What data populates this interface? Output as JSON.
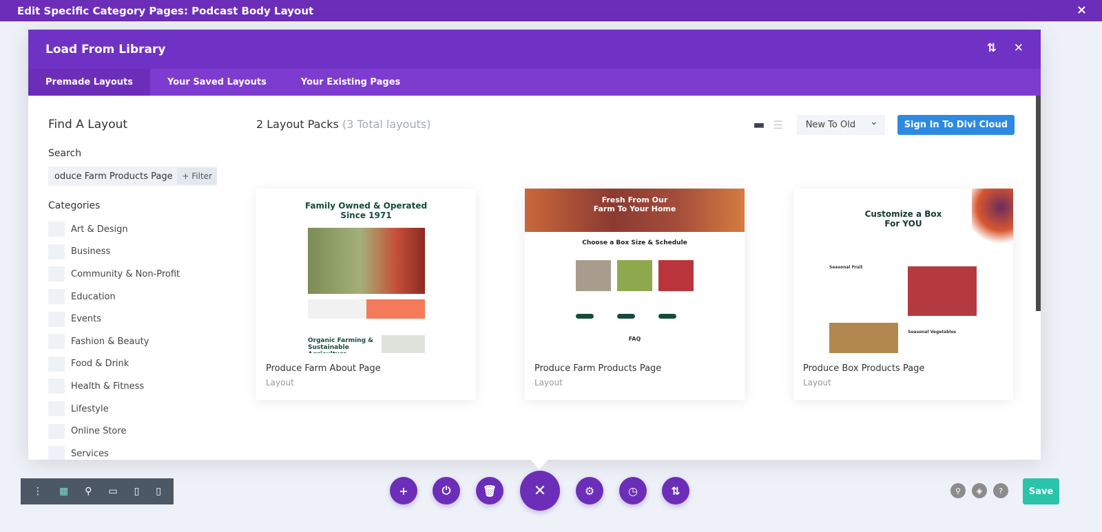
{
  "window": {
    "title": "Edit Specific Category Pages: Podcast Body Layout",
    "close_icon": "×"
  },
  "modal": {
    "title": "Load From Library",
    "tabs": [
      "Premade Layouts",
      "Your Saved Layouts",
      "Your Existing Pages"
    ],
    "active_tab": 0
  },
  "sidebar": {
    "heading": "Find A Layout",
    "search_label": "Search",
    "search_value": "oduce Farm Products Page",
    "filter_label": "+ Filter",
    "categories_label": "Categories",
    "categories": [
      "Art & Design",
      "Business",
      "Community & Non-Profit",
      "Education",
      "Events",
      "Fashion & Beauty",
      "Food & Drink",
      "Health & Fitness",
      "Lifestyle",
      "Online Store",
      "Services"
    ]
  },
  "main": {
    "packs_label": "2 Layout Packs",
    "total_label": "(3 Total layouts)",
    "sort_value": "New To Old",
    "cloud_button": "Sign In To Divi Cloud",
    "cards": [
      {
        "title": "Produce Farm About Page",
        "type": "Layout",
        "thumb_heading": "Family Owned & Operated Since 1971",
        "thumb_sub": "Organic Farming & Sustainable Agriculture"
      },
      {
        "title": "Produce Farm Products Page",
        "type": "Layout",
        "thumb_heading": "Fresh From Our Farm To Your Home",
        "thumb_sub": "Choose a Box Size & Schedule",
        "thumb_faq": "FAQ"
      },
      {
        "title": "Produce Box Products Page",
        "type": "Layout",
        "thumb_heading": "Customize a Box For YOU",
        "thumb_sub": "Seasonal Fruit",
        "thumb_sub2": "Seasonal Vegetables"
      }
    ]
  },
  "footer": {
    "save_label": "Save"
  },
  "colors": {
    "purple": "#6c2eb9",
    "tab_bar": "#7e3bd0",
    "blue": "#2d8ae2",
    "save": "#29c4a9",
    "toolbar": "#4c5866"
  }
}
